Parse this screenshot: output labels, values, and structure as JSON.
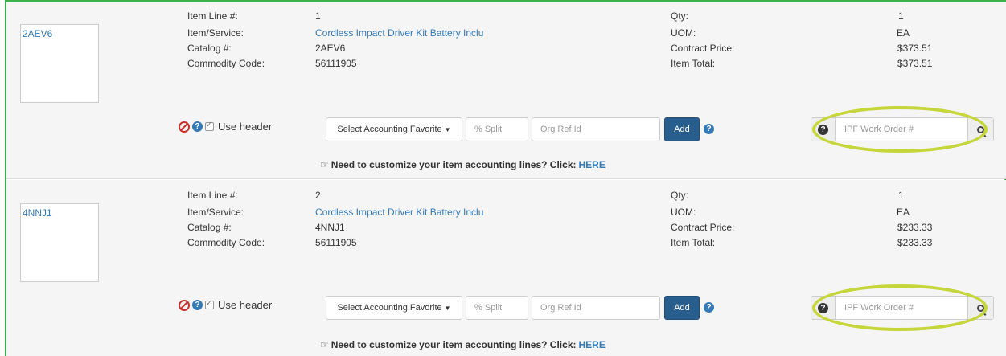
{
  "labels": {
    "item_line": "Item Line #:",
    "item_service": "Item/Service:",
    "catalog": "Catalog #:",
    "commodity": "Commodity Code:",
    "qty": "Qty:",
    "uom": "UOM:",
    "contract_price": "Contract Price:",
    "item_total": "Item Total:",
    "use_header": "Use header",
    "select_fav": "Select Accounting Favorite",
    "split_placeholder": "% Split",
    "orgref_placeholder": "Org Ref Id",
    "add": "Add",
    "ipf_placeholder": "IPF Work Order #",
    "customize_text": "Need to customize your item accounting lines? Click:",
    "customize_link": "HERE"
  },
  "items": [
    {
      "thumb": "2AEV6",
      "line": "1",
      "service": "Cordless Impact Driver Kit Battery Inclu",
      "catalog": "2AEV6",
      "commodity": "56111905",
      "qty": "1",
      "uom": "EA",
      "contract_price": "$373.51",
      "item_total": "$373.51"
    },
    {
      "thumb": "4NNJ1",
      "line": "2",
      "service": "Cordless Impact Driver Kit Battery Inclu",
      "catalog": "4NNJ1",
      "commodity": "56111905",
      "qty": "1",
      "uom": "EA",
      "contract_price": "$233.33",
      "item_total": "$233.33"
    }
  ],
  "colors": {
    "frame": "#3cb44b",
    "highlight": "#c6d63a",
    "add_button": "#285e8e",
    "link": "#337ab7"
  },
  "icons": {
    "remove": "no-entry-icon",
    "help": "question-circle-icon",
    "checkbox": "checkbox-checked-icon",
    "search": "magnifier-icon",
    "hand": "pointing-hand-icon"
  }
}
